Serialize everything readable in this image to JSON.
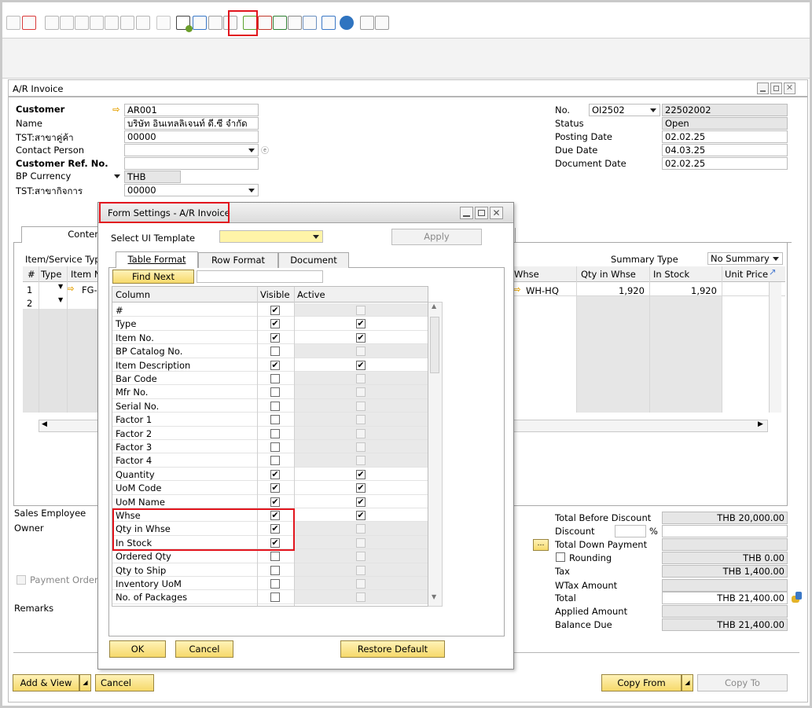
{
  "colors": {
    "accent": "#f6d96a",
    "highlight": "#e2151d",
    "selected_row": "#fffbd0"
  },
  "toolbar": {
    "icons": [
      "filter-icon",
      "sort-icon",
      "first-record-icon",
      "previous-record-icon",
      "next-record-icon",
      "last-record-icon",
      "structure-icon",
      "gross-profit-icon",
      "relationship-map-icon",
      "edit-icon",
      "form-settings-icon",
      "settings-icon",
      "messages-icon",
      "alerts-icon",
      "calendar-icon",
      "email-icon",
      "excel-icon",
      "hierarchy-icon",
      "user-icon",
      "browser-icon",
      "help-icon",
      "print-icon",
      "print-preview-icon"
    ]
  },
  "window": {
    "title": "A/R Invoice"
  },
  "header": {
    "customer_label": "Customer",
    "customer_value": "AR001",
    "name_label": "Name",
    "name_value": "บริษัท อินเทลลิเจนท์ ดี.ซี จำกัด",
    "tst_branch_label": "TST:สาขาคู่ค้า",
    "tst_branch_value": "00000",
    "contact_label": "Contact Person",
    "contact_value": "",
    "custref_label": "Customer Ref. No.",
    "custref_value": "",
    "currency_label": "BP Currency",
    "currency_value": "THB",
    "tst_biz_label": "TST:สาขากิจการ",
    "tst_biz_value": "00000"
  },
  "right_header": {
    "no_label": "No.",
    "series": "OI2502",
    "doc_no": "22502002",
    "status_label": "Status",
    "status_value": "Open",
    "posting_label": "Posting Date",
    "posting_value": "02.02.25",
    "due_label": "Due Date",
    "due_value": "04.03.25",
    "docdate_label": "Document Date",
    "docdate_value": "02.02.25"
  },
  "tabs": {
    "contents": "Content"
  },
  "items": {
    "item_service_label": "Item/Service Typ",
    "summary_type_label": "Summary Type",
    "summary_type_value": "No Summary",
    "left_cols": [
      "#",
      "Type",
      "Item N"
    ],
    "right_cols": [
      "Whse",
      "Qty in Whse",
      "In Stock",
      "Unit Price"
    ],
    "row1": {
      "no": "1",
      "item": "FG-(",
      "whse": "WH-HQ",
      "qty_whse": "1,920",
      "in_stock": "1,920"
    },
    "row2": {
      "no": "2"
    }
  },
  "footer_left": {
    "sales_employee": "Sales Employee",
    "owner": "Owner",
    "payment_order": "Payment Order I",
    "remarks": "Remarks"
  },
  "totals": {
    "tbd_label": "Total Before Discount",
    "tbd_value": "THB 20,000.00",
    "discount_label": "Discount",
    "discount_pct": "%",
    "tdp_label": "Total Down Payment",
    "rounding_label": "Rounding",
    "rounding_value": "THB 0.00",
    "tax_label": "Tax",
    "tax_value": "THB 1,400.00",
    "wtax_label": "WTax Amount",
    "total_label": "Total",
    "total_value": "THB 21,400.00",
    "applied_label": "Applied Amount",
    "balance_label": "Balance Due",
    "balance_value": "THB 21,400.00"
  },
  "bottom_buttons": {
    "add_view": "Add & View",
    "cancel": "Cancel",
    "copy_from": "Copy From",
    "copy_to": "Copy To"
  },
  "dialog": {
    "title": "Form Settings - A/R Invoice",
    "template_label": "Select UI Template",
    "template_value": "",
    "apply": "Apply",
    "tabs": [
      "Table Format",
      "Row Format",
      "Document"
    ],
    "find_next": "Find Next",
    "find_value": "",
    "col_header": "Column",
    "visible_header": "Visible",
    "active_header": "Active",
    "rows": [
      {
        "name": "#",
        "visible": true,
        "active": false,
        "active_enabled": false
      },
      {
        "name": "Type",
        "visible": true,
        "active": true,
        "active_enabled": true
      },
      {
        "name": "Item No.",
        "visible": true,
        "active": true,
        "active_enabled": true
      },
      {
        "name": "BP Catalog No.",
        "visible": false,
        "active": false,
        "active_enabled": false
      },
      {
        "name": "Item Description",
        "visible": true,
        "active": true,
        "active_enabled": true
      },
      {
        "name": "Bar Code",
        "visible": false,
        "active": false,
        "active_enabled": false
      },
      {
        "name": "Mfr No.",
        "visible": false,
        "active": false,
        "active_enabled": false
      },
      {
        "name": "Serial No.",
        "visible": false,
        "active": false,
        "active_enabled": false
      },
      {
        "name": "Factor 1",
        "visible": false,
        "active": false,
        "active_enabled": false
      },
      {
        "name": "Factor 2",
        "visible": false,
        "active": false,
        "active_enabled": false
      },
      {
        "name": "Factor 3",
        "visible": false,
        "active": false,
        "active_enabled": false
      },
      {
        "name": "Factor 4",
        "visible": false,
        "active": false,
        "active_enabled": false
      },
      {
        "name": "Quantity",
        "visible": true,
        "active": true,
        "active_enabled": true
      },
      {
        "name": "UoM Code",
        "visible": true,
        "active": true,
        "active_enabled": true
      },
      {
        "name": "UoM Name",
        "visible": true,
        "active": true,
        "active_enabled": true
      },
      {
        "name": "Whse",
        "visible": true,
        "active": true,
        "active_enabled": true
      },
      {
        "name": "Qty in Whse",
        "visible": true,
        "active": false,
        "active_enabled": false
      },
      {
        "name": "In Stock",
        "visible": true,
        "active": false,
        "active_enabled": false
      },
      {
        "name": "Ordered Qty",
        "visible": false,
        "active": false,
        "active_enabled": false
      },
      {
        "name": "Qty to Ship",
        "visible": false,
        "active": false,
        "active_enabled": false
      },
      {
        "name": "Inventory UoM",
        "visible": false,
        "active": false,
        "active_enabled": false
      },
      {
        "name": "No. of Packages",
        "visible": false,
        "active": false,
        "active_enabled": false
      }
    ],
    "ok": "OK",
    "cancel": "Cancel",
    "restore": "Restore Default"
  }
}
